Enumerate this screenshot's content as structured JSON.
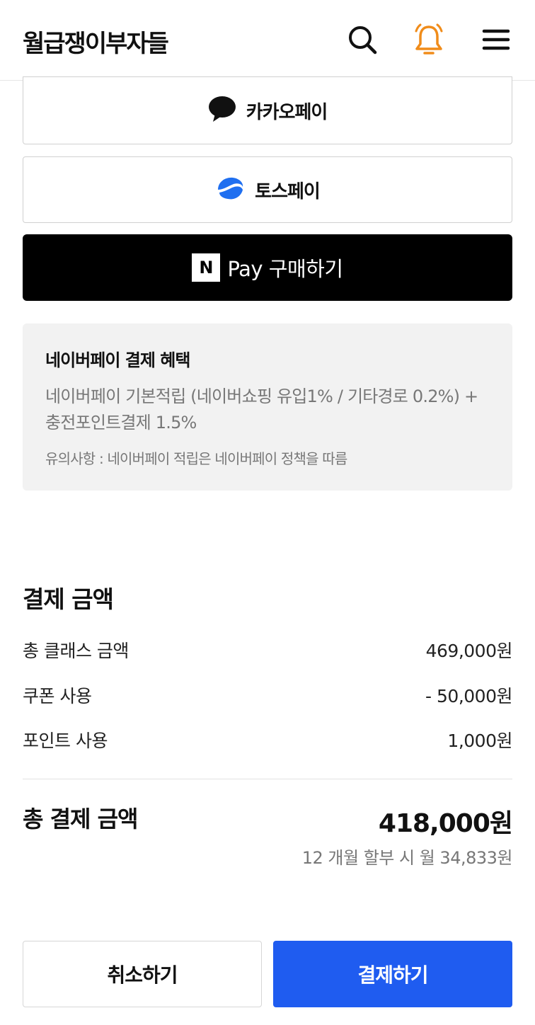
{
  "header": {
    "brand": "월급쟁이부자들",
    "icons": [
      "search-icon",
      "bell-icon",
      "menu-icon"
    ],
    "bell_color": "#f08c1a"
  },
  "payment_methods": {
    "kakaopay_label": "카카오페이",
    "tosspay_label": "토스페이",
    "npay_logo_letter": "N",
    "npay_label": "Pay 구매하기",
    "toss_color": "#1f6ff0"
  },
  "benefit": {
    "title": "네이버페이 결제 혜택",
    "description": "네이버페이 기본적립 (네이버쇼핑 유입1% / 기타경로 0.2%) + 충전포인트결제 1.5%",
    "note": "유의사항 : 네이버페이 적립은 네이버페이 정책을 따름"
  },
  "summary": {
    "title": "결제 금액",
    "rows": [
      {
        "label": "총 클래스 금액",
        "value": "469,000원"
      },
      {
        "label": "쿠폰 사용",
        "value": "- 50,000원"
      },
      {
        "label": "포인트 사용",
        "value": "1,000원"
      }
    ],
    "total_label": "총 결제 금액",
    "total_value": "418,000원",
    "installment": "12 개월 할부 시 월 34,833원"
  },
  "actions": {
    "cancel_label": "취소하기",
    "pay_label": "결제하기",
    "pay_color": "#1f5cf0"
  }
}
